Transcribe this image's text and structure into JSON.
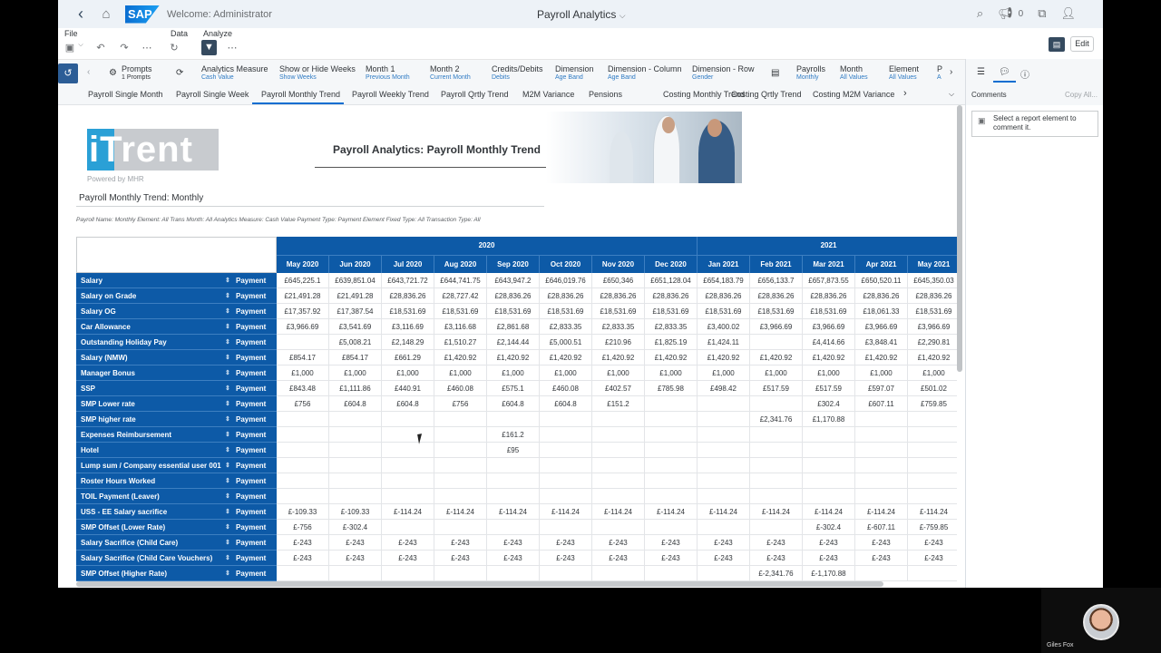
{
  "shell": {
    "welcome": "Welcome: Administrator",
    "title": "Payroll Analytics",
    "notifications": "0"
  },
  "menus": {
    "file": "File",
    "data": "Data",
    "analyze": "Analyze",
    "edit": "Edit"
  },
  "command_bar": {
    "items": [
      {
        "title": "Prompts",
        "sub": "1 Prompts"
      },
      {
        "title": "Analytics Measure",
        "sub": "Cash Value"
      },
      {
        "title": "Show or Hide Weeks",
        "sub": "Show Weeks"
      },
      {
        "title": "Month 1",
        "sub": "Previous Month"
      },
      {
        "title": "Month 2",
        "sub": "Current Month"
      },
      {
        "title": "Credits/Debits",
        "sub": "Debits"
      },
      {
        "title": "Dimension",
        "sub": "Age Band"
      },
      {
        "title": "Dimension - Column",
        "sub": "Age Band"
      },
      {
        "title": "Dimension - Row",
        "sub": "Gender"
      },
      {
        "title": "Payrolls",
        "sub": "Monthly"
      },
      {
        "title": "Month",
        "sub": "All Values"
      },
      {
        "title": "Element",
        "sub": "All Values"
      },
      {
        "title": "P",
        "sub": "A"
      }
    ]
  },
  "tabs": [
    "Payroll Single Month",
    "Payroll Single Week",
    "Payroll Monthly Trend",
    "Payroll Weekly Trend",
    "Payroll Qrtly Trend",
    "M2M Variance",
    "Pensions",
    "Costing Monthly Trend",
    "Costing Qrtly Trend",
    "Costing M2M Variance"
  ],
  "active_tab": "Payroll Monthly Trend",
  "side": {
    "comments": "Comments",
    "copy_all": "Copy All...",
    "note": "Select a report element to comment it."
  },
  "report": {
    "logo_text": "iTrent",
    "powered": "Powered by MHR",
    "title": "Payroll Analytics: Payroll Monthly Trend",
    "subtitle": "Payroll Monthly Trend: Monthly",
    "filters": "Payroll Name: Monthly  Element: All  Trans Month: All  Analytics Measure: Cash Value  Payment Type: Payment  Element Fixed Type: All  Transaction Type: All"
  },
  "table": {
    "years": [
      {
        "label": "2020",
        "span": 8
      },
      {
        "label": "2021",
        "span": 5
      }
    ],
    "months": [
      "May 2020",
      "Jun 2020",
      "Jul 2020",
      "Aug 2020",
      "Sep 2020",
      "Oct 2020",
      "Nov 2020",
      "Dec 2020",
      "Jan 2021",
      "Feb 2021",
      "Mar 2021",
      "Apr 2021",
      "May 2021"
    ],
    "rows": [
      {
        "label": "Salary",
        "type": "Payment",
        "values": [
          "£645,225.1",
          "£639,851.04",
          "£643,721.72",
          "£644,741.75",
          "£643,947.2",
          "£646,019.76",
          "£650,346",
          "£651,128.04",
          "£654,183.79",
          "£656,133.7",
          "£657,873.55",
          "£650,520.11",
          "£645,350.03"
        ]
      },
      {
        "label": "Salary on Grade",
        "type": "Payment",
        "values": [
          "£21,491.28",
          "£21,491.28",
          "£28,836.26",
          "£28,727.42",
          "£28,836.26",
          "£28,836.26",
          "£28,836.26",
          "£28,836.26",
          "£28,836.26",
          "£28,836.26",
          "£28,836.26",
          "£28,836.26",
          "£28,836.26"
        ]
      },
      {
        "label": "Salary OG",
        "type": "Payment",
        "values": [
          "£17,357.92",
          "£17,387.54",
          "£18,531.69",
          "£18,531.69",
          "£18,531.69",
          "£18,531.69",
          "£18,531.69",
          "£18,531.69",
          "£18,531.69",
          "£18,531.69",
          "£18,531.69",
          "£18,061.33",
          "£18,531.69"
        ]
      },
      {
        "label": "Car Allowance",
        "type": "Payment",
        "values": [
          "£3,966.69",
          "£3,541.69",
          "£3,116.69",
          "£3,116.68",
          "£2,861.68",
          "£2,833.35",
          "£2,833.35",
          "£2,833.35",
          "£3,400.02",
          "£3,966.69",
          "£3,966.69",
          "£3,966.69",
          "£3,966.69"
        ]
      },
      {
        "label": "Outstanding Holiday Pay",
        "type": "Payment",
        "values": [
          "",
          "£5,008.21",
          "£2,148.29",
          "£1,510.27",
          "£2,144.44",
          "£5,000.51",
          "£210.96",
          "£1,825.19",
          "£1,424.11",
          "",
          "£4,414.66",
          "£3,848.41",
          "£2,290.81"
        ]
      },
      {
        "label": "Salary (NMW)",
        "type": "Payment",
        "values": [
          "£854.17",
          "£854.17",
          "£661.29",
          "£1,420.92",
          "£1,420.92",
          "£1,420.92",
          "£1,420.92",
          "£1,420.92",
          "£1,420.92",
          "£1,420.92",
          "£1,420.92",
          "£1,420.92",
          "£1,420.92"
        ]
      },
      {
        "label": "Manager Bonus",
        "type": "Payment",
        "values": [
          "£1,000",
          "£1,000",
          "£1,000",
          "£1,000",
          "£1,000",
          "£1,000",
          "£1,000",
          "£1,000",
          "£1,000",
          "£1,000",
          "£1,000",
          "£1,000",
          "£1,000"
        ]
      },
      {
        "label": "SSP",
        "type": "Payment",
        "values": [
          "£843.48",
          "£1,111.86",
          "£440.91",
          "£460.08",
          "£575.1",
          "£460.08",
          "£402.57",
          "£785.98",
          "£498.42",
          "£517.59",
          "£517.59",
          "£597.07",
          "£501.02"
        ]
      },
      {
        "label": "SMP Lower rate",
        "type": "Payment",
        "values": [
          "£756",
          "£604.8",
          "£604.8",
          "£756",
          "£604.8",
          "£604.8",
          "£151.2",
          "",
          "",
          "",
          "£302.4",
          "£607.11",
          "£759.85"
        ]
      },
      {
        "label": "SMP higher rate",
        "type": "Payment",
        "values": [
          "",
          "",
          "",
          "",
          "",
          "",
          "",
          "",
          "",
          "£2,341.76",
          "£1,170.88",
          "",
          ""
        ]
      },
      {
        "label": "Expenses Reimbursement",
        "type": "Payment",
        "values": [
          "",
          "",
          "",
          "",
          "£161.2",
          "",
          "",
          "",
          "",
          "",
          "",
          "",
          ""
        ]
      },
      {
        "label": "Hotel",
        "type": "Payment",
        "values": [
          "",
          "",
          "",
          "",
          "£95",
          "",
          "",
          "",
          "",
          "",
          "",
          "",
          ""
        ]
      },
      {
        "label": "Lump sum / Company essential user 001",
        "type": "Payment",
        "values": [
          "",
          "",
          "",
          "",
          "",
          "",
          "",
          "",
          "",
          "",
          "",
          "",
          ""
        ]
      },
      {
        "label": "Roster Hours Worked",
        "type": "Payment",
        "values": [
          "",
          "",
          "",
          "",
          "",
          "",
          "",
          "",
          "",
          "",
          "",
          "",
          ""
        ]
      },
      {
        "label": "TOIL Payment (Leaver)",
        "type": "Payment",
        "values": [
          "",
          "",
          "",
          "",
          "",
          "",
          "",
          "",
          "",
          "",
          "",
          "",
          ""
        ]
      },
      {
        "label": "USS - EE Salary sacrifice",
        "type": "Payment",
        "values": [
          "£-109.33",
          "£-109.33",
          "£-114.24",
          "£-114.24",
          "£-114.24",
          "£-114.24",
          "£-114.24",
          "£-114.24",
          "£-114.24",
          "£-114.24",
          "£-114.24",
          "£-114.24",
          "£-114.24"
        ]
      },
      {
        "label": "SMP Offset (Lower Rate)",
        "type": "Payment",
        "values": [
          "£-756",
          "£-302.4",
          "",
          "",
          "",
          "",
          "",
          "",
          "",
          "",
          "£-302.4",
          "£-607.11",
          "£-759.85"
        ]
      },
      {
        "label": "Salary Sacrifice (Child Care)",
        "type": "Payment",
        "values": [
          "£-243",
          "£-243",
          "£-243",
          "£-243",
          "£-243",
          "£-243",
          "£-243",
          "£-243",
          "£-243",
          "£-243",
          "£-243",
          "£-243",
          "£-243"
        ]
      },
      {
        "label": "Salary Sacrifice (Child Care Vouchers)",
        "type": "Payment",
        "values": [
          "£-243",
          "£-243",
          "£-243",
          "£-243",
          "£-243",
          "£-243",
          "£-243",
          "£-243",
          "£-243",
          "£-243",
          "£-243",
          "£-243",
          "£-243"
        ]
      },
      {
        "label": "SMP Offset (Higher Rate)",
        "type": "Payment",
        "values": [
          "",
          "",
          "",
          "",
          "",
          "",
          "",
          "",
          "",
          "£-2,341.76",
          "£-1,170.88",
          "",
          ""
        ]
      }
    ]
  },
  "webcam": {
    "name": "Giles Fox"
  },
  "colors": {
    "header_blue": "#0d5aa7",
    "accent": "#0a6ed1",
    "shell_bg": "#edf2f7"
  }
}
